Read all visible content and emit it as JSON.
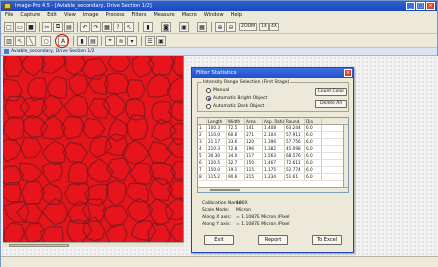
{
  "window": {
    "title": "Image-Pro 4.5 - [Aviable_secondary, Drive Section 1/2]",
    "minimize": "_",
    "maximize": "□",
    "close": "×"
  },
  "menu": [
    "File",
    "Capture",
    "Edit",
    "View",
    "Image",
    "Process",
    "Filters",
    "Measure",
    "Macro",
    "Window",
    "Help"
  ],
  "toolbar2": {
    "zoom_label": "ZOOM",
    "scale_label": "1X",
    "fit_label": "4X"
  },
  "document": {
    "title": "Aviable_secondary, Drive Section 1/2"
  },
  "dialog": {
    "title": "Filter Statistics",
    "group_title": "Intensity Range Selection (First Stage)",
    "radios": [
      {
        "label": "Manual",
        "selected": false
      },
      {
        "label": "Automatic Bright Object",
        "selected": true
      },
      {
        "label": "Automatic Dark Object",
        "selected": false
      }
    ],
    "buttons": {
      "count_color": "Count Color",
      "delete_all": "Delete All",
      "exit": "Exit",
      "report": "Report",
      "to_excel": "To Excel"
    },
    "columns": [
      "",
      "Length",
      "Width",
      "Area",
      "Asp. Ratio",
      "Round.",
      "Dia"
    ],
    "rows": [
      [
        "1",
        "100.3",
        "72.5",
        "141",
        "1.408",
        "63.244",
        "6.0"
      ],
      [
        "2",
        "110.0",
        "60.6",
        "271",
        "2.104",
        "57.911",
        "6.0"
      ],
      [
        "3",
        "21.17",
        "33.6",
        "120",
        "1.396",
        "57.756",
        "6.0"
      ],
      [
        "4",
        "210.3",
        "72.8",
        "196",
        "1.382",
        "45.098",
        "6.0"
      ],
      [
        "5",
        "30.30",
        "34.0",
        "117",
        "1.563",
        "68.576",
        "6.0"
      ],
      [
        "6",
        "120.5",
        "32.7",
        "150",
        "1.467",
        "72.611",
        "6.0"
      ],
      [
        "7",
        "150.0",
        "19.1",
        "115",
        "1.175",
        "52.774",
        "6.0"
      ],
      [
        "8",
        "115.2",
        "90.6",
        "215",
        "1.234",
        "51.61",
        "6.0"
      ]
    ],
    "info": [
      {
        "key": "Calibration Name:",
        "value": "100X"
      },
      {
        "key": "Scale Mode:",
        "value": "Micron"
      },
      {
        "key": "Along X axis:",
        "value": "= 1.1087E Micron /Pixel"
      },
      {
        "key": "Along Y axis:",
        "value": "= 1.1087E Micron /Pixel"
      }
    ]
  },
  "colors": {
    "image_red": "#e8141c",
    "grain_boundary": "#7a1a1f",
    "title_blue": "#2150c8"
  }
}
